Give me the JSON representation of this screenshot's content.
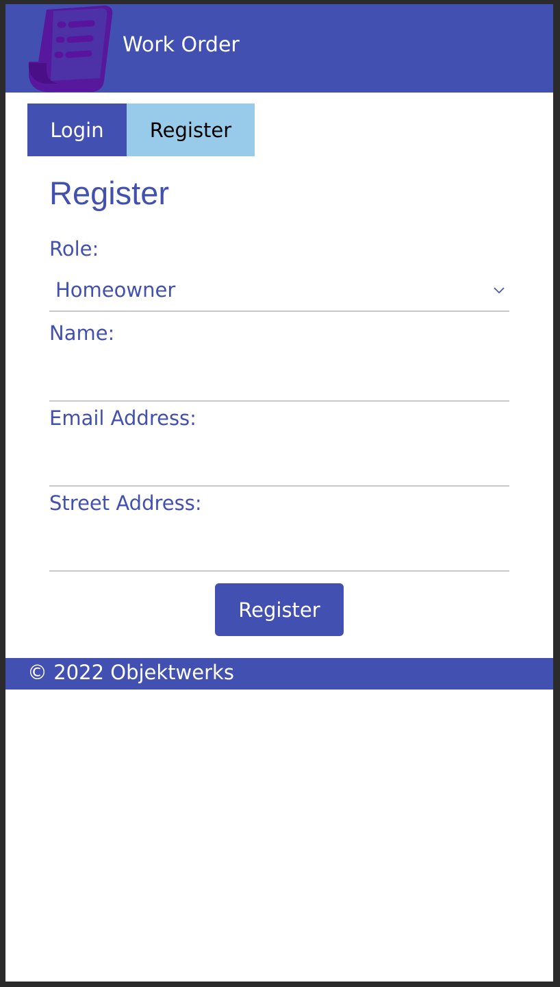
{
  "header": {
    "logo_icon": "document-list-icon",
    "title": "Work Order"
  },
  "tabs": [
    {
      "label": "Login",
      "active": false
    },
    {
      "label": "Register",
      "active": true
    }
  ],
  "form": {
    "title": "Register",
    "role": {
      "label": "Role:",
      "value": "Homeowner"
    },
    "name": {
      "label": "Name:",
      "value": ""
    },
    "email": {
      "label": "Email Address:",
      "value": ""
    },
    "street": {
      "label": "Street Address:",
      "value": ""
    },
    "submit_label": "Register"
  },
  "footer": {
    "text": "© 2022 Objektwerks"
  },
  "colors": {
    "primary": "#4150b1",
    "tab_selected": "#97cbe9",
    "logo": "#5a139c"
  }
}
